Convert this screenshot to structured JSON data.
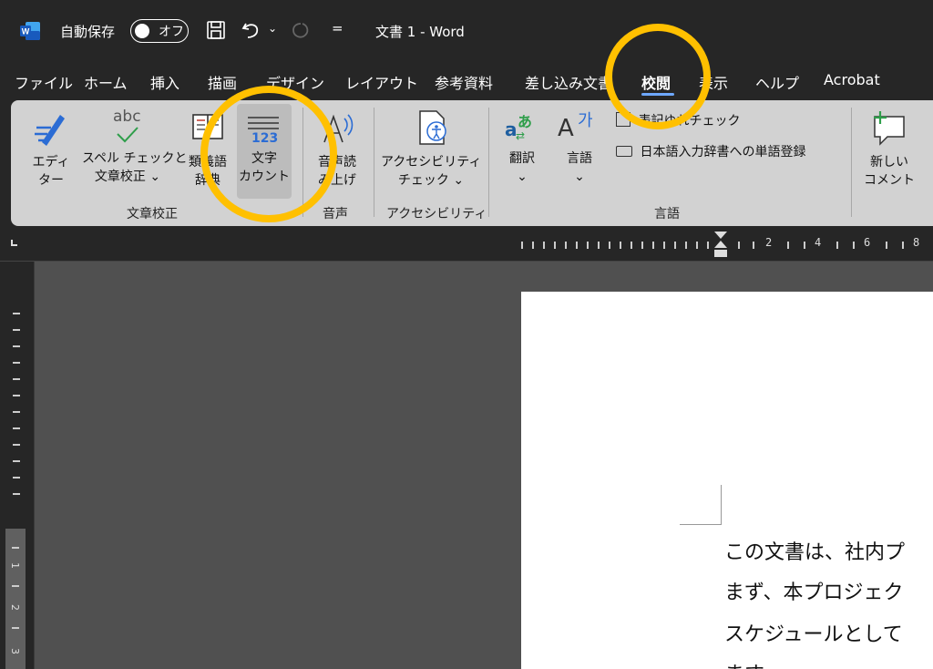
{
  "titlebar": {
    "autosave_label": "自動保存",
    "autosave_state": "オフ",
    "document_title": "文書 1  -  Word"
  },
  "tabs": [
    {
      "label": "ファイル"
    },
    {
      "label": "ホーム"
    },
    {
      "label": "挿入"
    },
    {
      "label": "描画"
    },
    {
      "label": "デザイン"
    },
    {
      "label": "レイアウト"
    },
    {
      "label": "参考資料"
    },
    {
      "label": "差し込み文書"
    },
    {
      "label": "校閲",
      "active": true
    },
    {
      "label": "表示"
    },
    {
      "label": "ヘルプ"
    },
    {
      "label": "Acrobat"
    }
  ],
  "ribbon": {
    "editor": {
      "line1": "エディ",
      "line2": "ター"
    },
    "spell": {
      "line1": "スペル チェックと",
      "line2": "文章校正 ⌄",
      "icon_text": "abc"
    },
    "thesaurus": {
      "line1": "類義語",
      "line2": "辞典"
    },
    "wordcount": {
      "line1": "文字",
      "line2": "カウント",
      "icon_text": "123"
    },
    "readaloud": {
      "line1": "音声読",
      "line2": "み上げ"
    },
    "accessibility": {
      "line1": "アクセシビリティ",
      "line2": "チェック ⌄"
    },
    "translate": {
      "line1": "翻訳",
      "line2": "⌄"
    },
    "language": {
      "line1": "言語",
      "line2": "⌄"
    },
    "kanji_check": "表記ゆれチェック",
    "dictionary": "日本語入力辞書への単語登録",
    "new_comment": {
      "line1": "新しい",
      "line2": "コメント"
    },
    "groups": {
      "proofing": "文章校正",
      "speech": "音声",
      "accessibility": "アクセシビリティ",
      "language": "言語"
    }
  },
  "ruler": {
    "numbers": [
      "2",
      "4",
      "6",
      "8"
    ],
    "vertical_numbers": [
      "1",
      "2",
      "3"
    ]
  },
  "document": {
    "lines": [
      "この文書は、社内プ",
      "まず、本プロジェク",
      "スケジュールとして",
      "ます。"
    ]
  },
  "colors": {
    "highlight_circle": "#ffc000",
    "ribbon_bg": "#d2d2d2",
    "app_bg": "#262626",
    "accent_blue": "#2b6cd4"
  }
}
